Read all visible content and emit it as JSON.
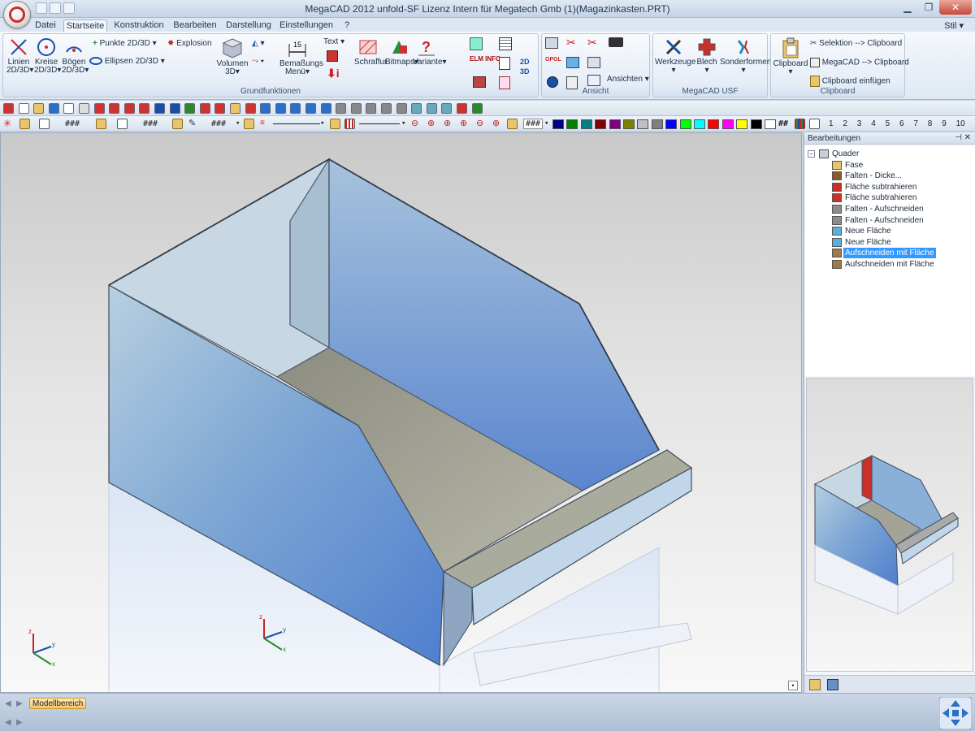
{
  "window": {
    "title": "MegaCAD 2012 unfold-SF  Lizenz Intern für Megatech Gmb (1)(Magazinkasten.PRT)"
  },
  "menu": {
    "tabs": [
      "Datei",
      "Startseite",
      "Konstruktion",
      "Bearbeiten",
      "Darstellung",
      "Einstellungen",
      "?"
    ],
    "active": "Startseite",
    "style_label": "Stil"
  },
  "ribbon": {
    "grundfunktionen": {
      "label": "Grundfunktionen",
      "linien_1": "Linien",
      "linien_2": "2D/3D",
      "kreise_1": "Kreise",
      "kreise_2": "2D/3D",
      "boegen_1": "Bögen",
      "boegen_2": "2D/3D",
      "punkte": "Punkte 2D/3D",
      "ellipsen": "Ellipsen 2D/3D",
      "explosion": "Explosion",
      "volumen_1": "Volumen",
      "volumen_2": "3D",
      "bemassung_1": "Bemaßungs",
      "bemassung_2": "Menü",
      "text": "Text",
      "schraffur": "Schraffur",
      "bitmaps": "Bitmaps",
      "variante": "Variante",
      "elm_info": "ELM INFO"
    },
    "ansicht": {
      "label": "Ansicht",
      "ansichten": "Ansichten"
    },
    "usf": {
      "label": "MegaCAD USF",
      "werkzeuge": "Werkzeuge",
      "blech": "Blech",
      "sonderformen": "Sonderformen"
    },
    "clipboard": {
      "label": "Clipboard",
      "clipboard_btn": "Clipboard",
      "selektion": "Selektion --> Clipboard",
      "megacad": "MegaCAD --> Clipboard",
      "einfuegen": "Clipboard einfügen"
    }
  },
  "toolbar2": {
    "field1": "###",
    "field2": "###",
    "field3": "###",
    "field4": "###",
    "palette": [
      "#000080",
      "#008000",
      "#008080",
      "#800000",
      "#800080",
      "#808000",
      "#c0c0c0",
      "#808080",
      "#0000ff",
      "#00ff00",
      "#00ffff",
      "#ff0000",
      "#ff00ff",
      "#ffff00",
      "#000000",
      "#ffffff"
    ],
    "hash_label": "##",
    "layers": [
      "1",
      "2",
      "3",
      "4",
      "5",
      "6",
      "7",
      "8",
      "9",
      "10"
    ]
  },
  "panel": {
    "title": "Bearbeitungen",
    "tree": [
      {
        "label": "Quader",
        "level": 0,
        "icon": "box-icon"
      },
      {
        "label": "Fase",
        "level": 1,
        "icon": "chamfer-icon"
      },
      {
        "label": "Falten - Dicke...",
        "level": 1,
        "icon": "fold-thickness-icon"
      },
      {
        "label": "Fläche subtrahieren",
        "level": 1,
        "icon": "subtract-face-icon"
      },
      {
        "label": "Fläche subtrahieren",
        "level": 1,
        "icon": "subtract-face-icon"
      },
      {
        "label": "Falten - Aufschneiden",
        "level": 1,
        "icon": "fold-cut-icon"
      },
      {
        "label": "Falten - Aufschneiden",
        "level": 1,
        "icon": "fold-cut-icon"
      },
      {
        "label": "Neue Fläche",
        "level": 1,
        "icon": "new-face-icon"
      },
      {
        "label": "Neue Fläche",
        "level": 1,
        "icon": "new-face-icon"
      },
      {
        "label": "Aufschneiden mit Fläche",
        "level": 1,
        "icon": "cut-face-icon",
        "selected": true
      },
      {
        "label": "Aufschneiden mit Fläche",
        "level": 1,
        "icon": "cut-face-icon"
      }
    ]
  },
  "axes": {
    "x": "x",
    "y": "y",
    "z": "z"
  },
  "status": {
    "model_tab": "Modellbereich"
  }
}
